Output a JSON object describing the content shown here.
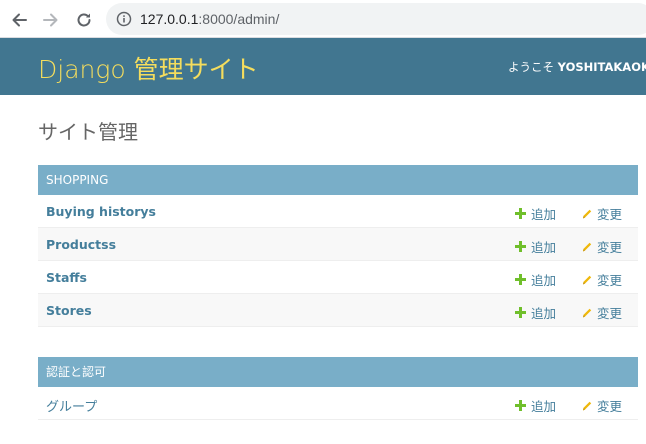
{
  "browser": {
    "url_host": "127.0.0.1",
    "url_rest": ":8000/admin/"
  },
  "header": {
    "brand": "Django 管理サイト",
    "welcome": "ようこそ ",
    "username": "YOSHITAKAOKA"
  },
  "page": {
    "title": "サイト管理"
  },
  "modules": [
    {
      "caption": "SHOPPING",
      "rows": [
        {
          "name": "Buying historys",
          "add": "追加",
          "change": "変更"
        },
        {
          "name": "Productss",
          "add": "追加",
          "change": "変更"
        },
        {
          "name": "Staffs",
          "add": "追加",
          "change": "変更"
        },
        {
          "name": "Stores",
          "add": "追加",
          "change": "変更"
        }
      ]
    },
    {
      "caption": "認証と認可",
      "rows": [
        {
          "name": "グループ",
          "add": "追加",
          "change": "変更"
        }
      ]
    }
  ],
  "colors": {
    "header_bg": "#417690",
    "brand": "#f5dd5d",
    "caption_bg": "#79aec8",
    "link": "#447e9b",
    "add_icon": "#70bf2b",
    "change_icon": "#efb80b"
  },
  "icons": {
    "back": "arrow-left-icon",
    "forward": "arrow-right-icon",
    "reload": "reload-icon",
    "info": "info-icon",
    "add": "plus-icon",
    "change": "pencil-icon"
  }
}
